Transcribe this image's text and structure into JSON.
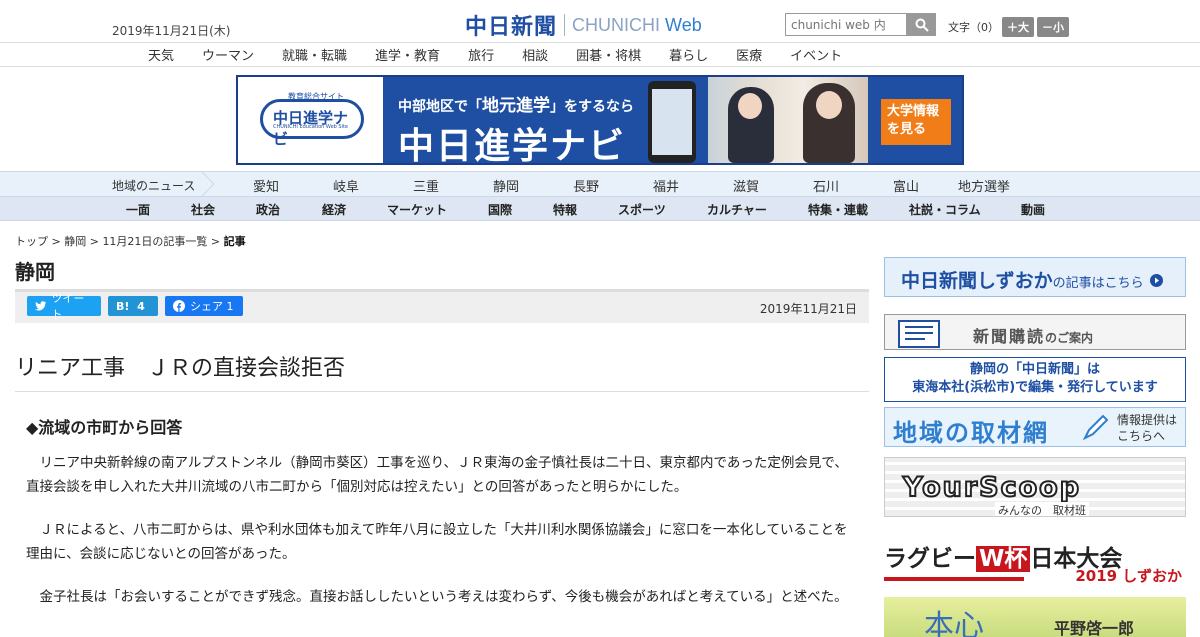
{
  "header": {
    "date": "2019年11月21日(木)",
    "logo_main": "中日新聞",
    "logo_sub_a": "CHUNICHI",
    "logo_sub_b": "Web",
    "search_placeholder": "chunichi web 内",
    "textsize_label": "文字（0）",
    "textsize_larger": "＋大",
    "textsize_smaller": "－小"
  },
  "category_nav": [
    "天気",
    "ウーマン",
    "就職・転職",
    "進学・教育",
    "旅行",
    "相談",
    "囲碁・将棋",
    "暮らし",
    "医療",
    "イベント"
  ],
  "banner": {
    "site_tag": "教育総合サイト",
    "logo_text": "中日進学ナビ",
    "logo_en": "CHUNICHI Education Web Site",
    "line1_a": "中部地区で「",
    "line1_b": "地元進学",
    "line1_c": "」をするなら",
    "line2": "中日進学ナビ",
    "cta": "大学情報を見る"
  },
  "region_nav": {
    "label": "地域のニュース",
    "items": [
      "愛知",
      "岐阜",
      "三重",
      "静岡",
      "長野",
      "福井",
      "滋賀",
      "石川",
      "富山",
      "地方選挙"
    ]
  },
  "main_nav": [
    "一面",
    "社会",
    "政治",
    "経済",
    "マーケット",
    "国際",
    "特報",
    "スポーツ",
    "カルチャー",
    "特集・連載",
    "社説・コラム",
    "動画"
  ],
  "breadcrumb": {
    "top": "トップ",
    "region": "静岡",
    "list": "11月21日の記事一覧",
    "current": "記事",
    "sep": " > "
  },
  "section_title": "静岡",
  "share": {
    "tweet": "ツイート",
    "hatena_label": "B!",
    "hatena_count": "4",
    "fb_label": "シェア",
    "fb_count": "1",
    "date": "2019年11月21日"
  },
  "article": {
    "title": "リニア工事　ＪＲの直接会談拒否",
    "subhead": "◆流域の市町から回答",
    "paragraphs": [
      "　リニア中央新幹線の南アルプストンネル（静岡市葵区）工事を巡り、ＪＲ東海の金子慎社長は二十日、東京都内であった定例会見で、直接会談を申し入れた大井川流域の八市二町から「個別対応は控えたい」との回答があったと明らかにした。",
      "　ＪＲによると、八市二町からは、県や利水団体も加えて昨年八月に設立した「大井川利水関係協議会」に窓口を一本化していることを理由に、会談に応じないとの回答があった。",
      "　金子社長は「お会いすることができず残念。直接お話ししたいという考えは変わらず、今後も機会があればと考えている」と述べた。"
    ]
  },
  "sidebar": {
    "ad1": "中日新聞しずおか",
    "ad1_small": "の記事はこちら",
    "ad2": "新聞購読",
    "ad2_small": "のご案内",
    "ad3_line1": "静岡の「中日新聞」は",
    "ad3_line2": "東海本社(浜松市)で編集・発行しています",
    "ad4": "地域の取材網",
    "ad4_note1": "情報提供は",
    "ad4_note2": "こちらへ",
    "ad5": "YourScoop",
    "ad5_sub": "みんなの　取材班",
    "ad6_a": "ラグビー",
    "ad6_w": "W杯",
    "ad6_b": "日本大会",
    "ad6_c": "2019 しずおか",
    "ad7": "本心",
    "ad7_name": "平野啓一郎"
  },
  "colors": {
    "brand_blue": "#1e4fa3",
    "twitter": "#1da1f2",
    "hatena": "#2294d6",
    "facebook": "#1877f2",
    "accent_orange": "#f07d17",
    "rugby_red": "#c8161d"
  }
}
